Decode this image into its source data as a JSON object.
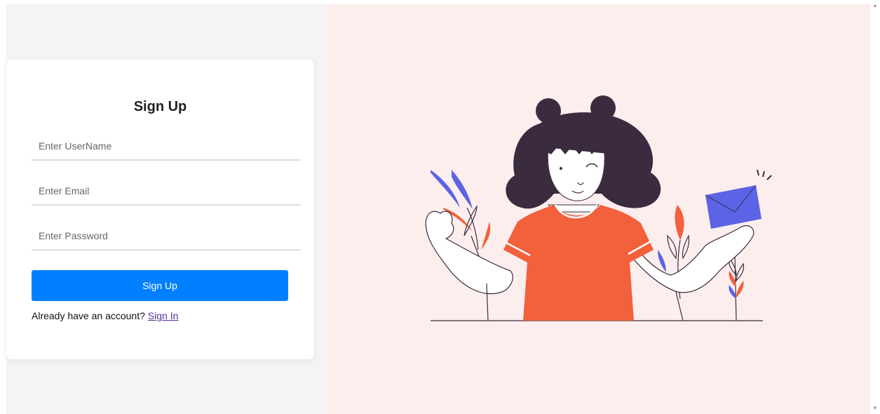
{
  "form": {
    "title": "Sign Up",
    "username_placeholder": "Enter UserName",
    "email_placeholder": "Enter Email",
    "password_placeholder": "Enter Password",
    "submit_label": "Sign Up",
    "signin_prompt": "Already have an account?",
    "signin_link": "Sign In"
  },
  "colors": {
    "left_bg": "#f4f4f4",
    "right_bg": "#fdeeee",
    "button": "#0080ff",
    "link": "#5a2e98",
    "shirt": "#f2603c",
    "hair": "#3a2c3e",
    "envelope": "#5b63e6"
  },
  "icons": {
    "illustration": "girl-waving-with-envelope-illustration",
    "scroll_up": "triangle-up-icon",
    "scroll_down": "triangle-down-icon"
  }
}
